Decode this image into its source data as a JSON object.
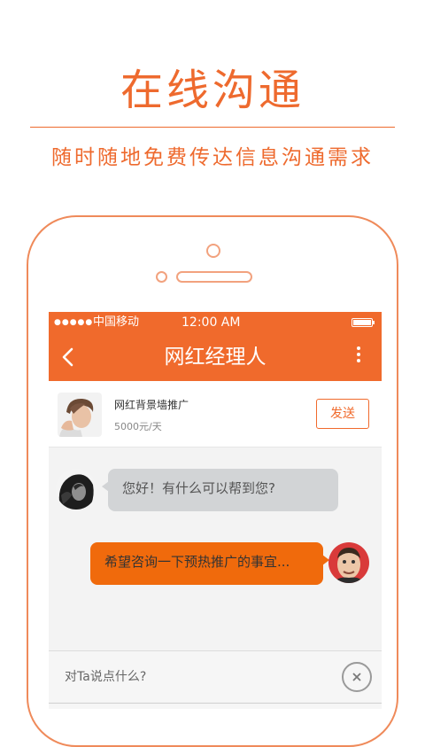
{
  "headline": "在线沟通",
  "subline": "随时随地免费传达信息沟通需求",
  "status_bar": {
    "signal": "●●●●●",
    "carrier": "中国移动",
    "time": "12:00  AM"
  },
  "nav": {
    "title": "网红经理人",
    "back_icon": "chevron-left-icon",
    "more_icon": "more-vertical-icon"
  },
  "product": {
    "name": "网红背景墙推广",
    "price": "5000元/天",
    "send_label": "发送"
  },
  "messages": [
    {
      "side": "incoming",
      "text": "您好！有什么可以帮到您?"
    },
    {
      "side": "outgoing",
      "text": "希望咨询一下预热推广的事宜..."
    }
  ],
  "input": {
    "placeholder": "对Ta说点什么?",
    "close_icon": "close-icon"
  },
  "colors": {
    "accent": "#f06a2c",
    "outgoing_bubble": "#f06a0c",
    "incoming_bubble": "#d2d4d6"
  }
}
